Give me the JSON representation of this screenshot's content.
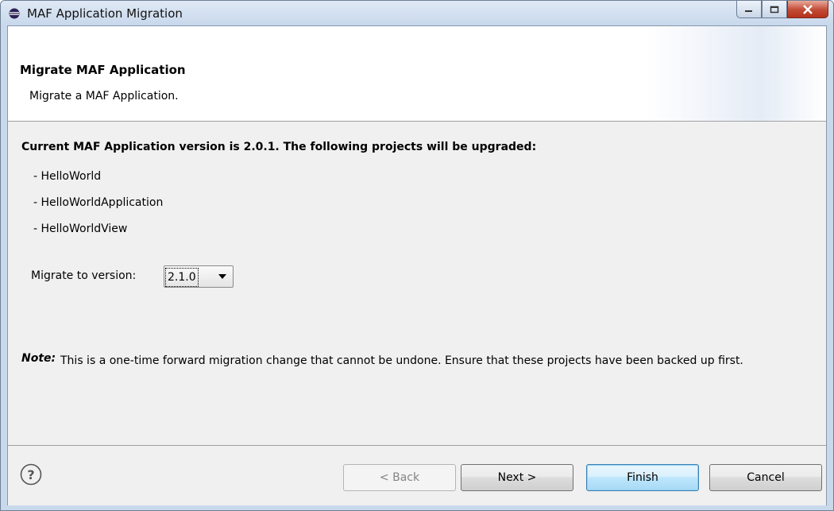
{
  "window": {
    "title": "MAF Application Migration"
  },
  "banner": {
    "title": "Migrate MAF Application",
    "description": "Migrate a MAF Application."
  },
  "main": {
    "current_version_text": "Current MAF Application version is 2.0.1. The following projects will be upgraded:",
    "projects": [
      "- HelloWorld",
      "- HelloWorldApplication",
      "- HelloWorldView"
    ],
    "migrate_label": "Migrate to version:",
    "migrate_version": "2.1.0",
    "note_label": "Note:",
    "note_text": "This is a one-time forward migration change that cannot be undone. Ensure that these projects have been backed up first."
  },
  "footer": {
    "back": "< Back",
    "next": "Next >",
    "finish": "Finish",
    "cancel": "Cancel"
  }
}
